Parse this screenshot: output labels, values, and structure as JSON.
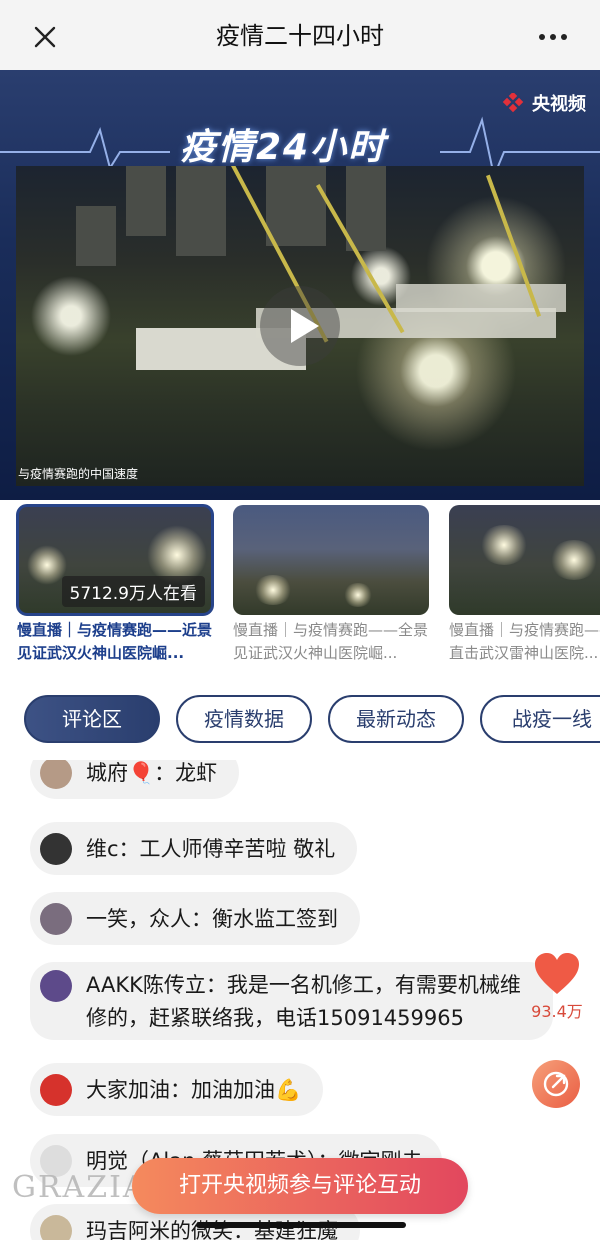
{
  "nav": {
    "title": "疫情二十四小时"
  },
  "banner": {
    "brand": "央视频",
    "title": "疫情24小时",
    "video_caption": "与疫情赛跑的中国速度"
  },
  "thumbs": [
    {
      "viewers": "5712.9万人在看",
      "caption": "慢直播｜与疫情赛跑——近景见证武汉火神山医院崛..."
    },
    {
      "caption": "慢直播｜与疫情赛跑——全景见证武汉火神山医院崛..."
    },
    {
      "caption": "慢直播｜与疫情赛跑——近景直击武汉雷神山医院..."
    }
  ],
  "tabs": [
    "评论区",
    "疫情数据",
    "最新动态",
    "战疫一线"
  ],
  "comments": [
    {
      "text": "城府🎈：龙虾"
    },
    {
      "text": "维c：工人师傅辛苦啦 敬礼"
    },
    {
      "text": "一笑，众人：衡水监工签到"
    },
    {
      "text": "AAKK陈传立：我是一名机修工，有需要机械维修的，赶紧联络我，电话15091459965"
    },
    {
      "text": "大家加油：加油加油💪"
    },
    {
      "text": "明觉（Alan 蔡菇田若术）：微宇刚未"
    },
    {
      "text": "玛吉阿米的微笑：基建狂魔"
    }
  ],
  "likes": "93.4万",
  "cta": "打开央视频参与评论互动",
  "watermark": "GRAZIA",
  "colors": {
    "accent": "#2a3e6e",
    "cta_start": "#f58a5d",
    "cta_end": "#e2475e",
    "heart": "#ef5a45"
  }
}
